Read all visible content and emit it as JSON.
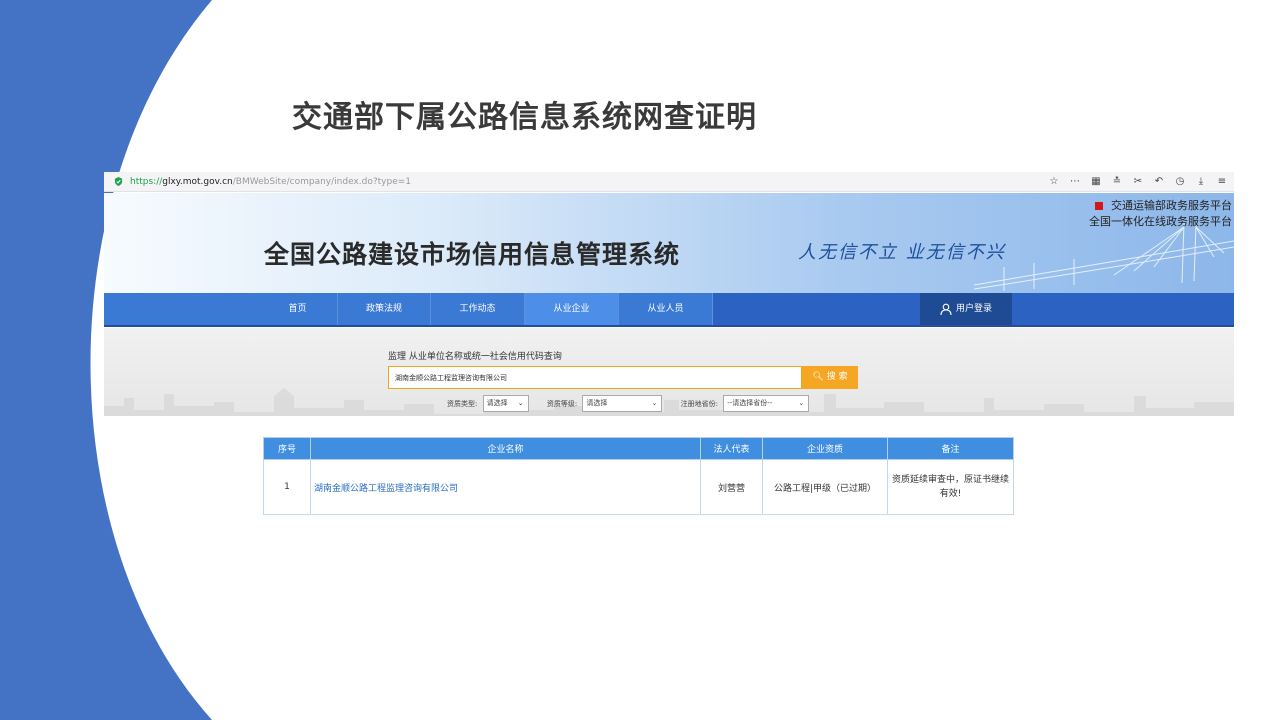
{
  "slide": {
    "title": "交通部下属公路信息系统网查证明"
  },
  "browser": {
    "url_protocol": "https://",
    "url_host": "glxy.mot.gov.cn",
    "url_path": "/BMWebSite/company/index.do?type=1",
    "toolbar_icons": [
      "star-icon",
      "more-icon",
      "grid-icon",
      "favorites-icon",
      "scissors-icon",
      "undo-icon",
      "history-icon",
      "download-icon",
      "menu-icon"
    ]
  },
  "site": {
    "title": "全国公路建设市场信用信息管理系统",
    "slogan": "人无信不立 业无信不兴",
    "platform_line1": "交通运输部政务服务平台",
    "platform_line2": "全国一体化在线政务服务平台"
  },
  "nav": {
    "items": [
      {
        "label": "首页"
      },
      {
        "label": "政策法规"
      },
      {
        "label": "工作动态"
      },
      {
        "label": "从业企业"
      },
      {
        "label": "从业人员"
      }
    ],
    "active": "从业企业",
    "login_label": "用户登录"
  },
  "search": {
    "label": "监理 从业单位名称或统一社会信用代码查询",
    "value": "湖南金顺公路工程监理咨询有限公司",
    "button_label": "搜 索",
    "filters": [
      {
        "label": "资质类型:",
        "value": "请选择"
      },
      {
        "label": "资质等级:",
        "value": "请选择"
      },
      {
        "label": "注册地省份:",
        "value": "--请选择省份--"
      }
    ]
  },
  "table": {
    "headers": [
      "序号",
      "企业名称",
      "法人代表",
      "企业资质",
      "备注"
    ],
    "rows": [
      {
        "index": "1",
        "name": "湖南金顺公路工程监理咨询有限公司",
        "legal_rep": "刘营营",
        "qualification": "公路工程|甲级（已过期）",
        "note": "资质延续审查中，原证书继续有效!"
      }
    ]
  },
  "colors": {
    "arc_blue": "#4472c4",
    "nav_blue": "#2c63c2",
    "table_header": "#3f8ee0",
    "search_accent": "#f5a623"
  }
}
